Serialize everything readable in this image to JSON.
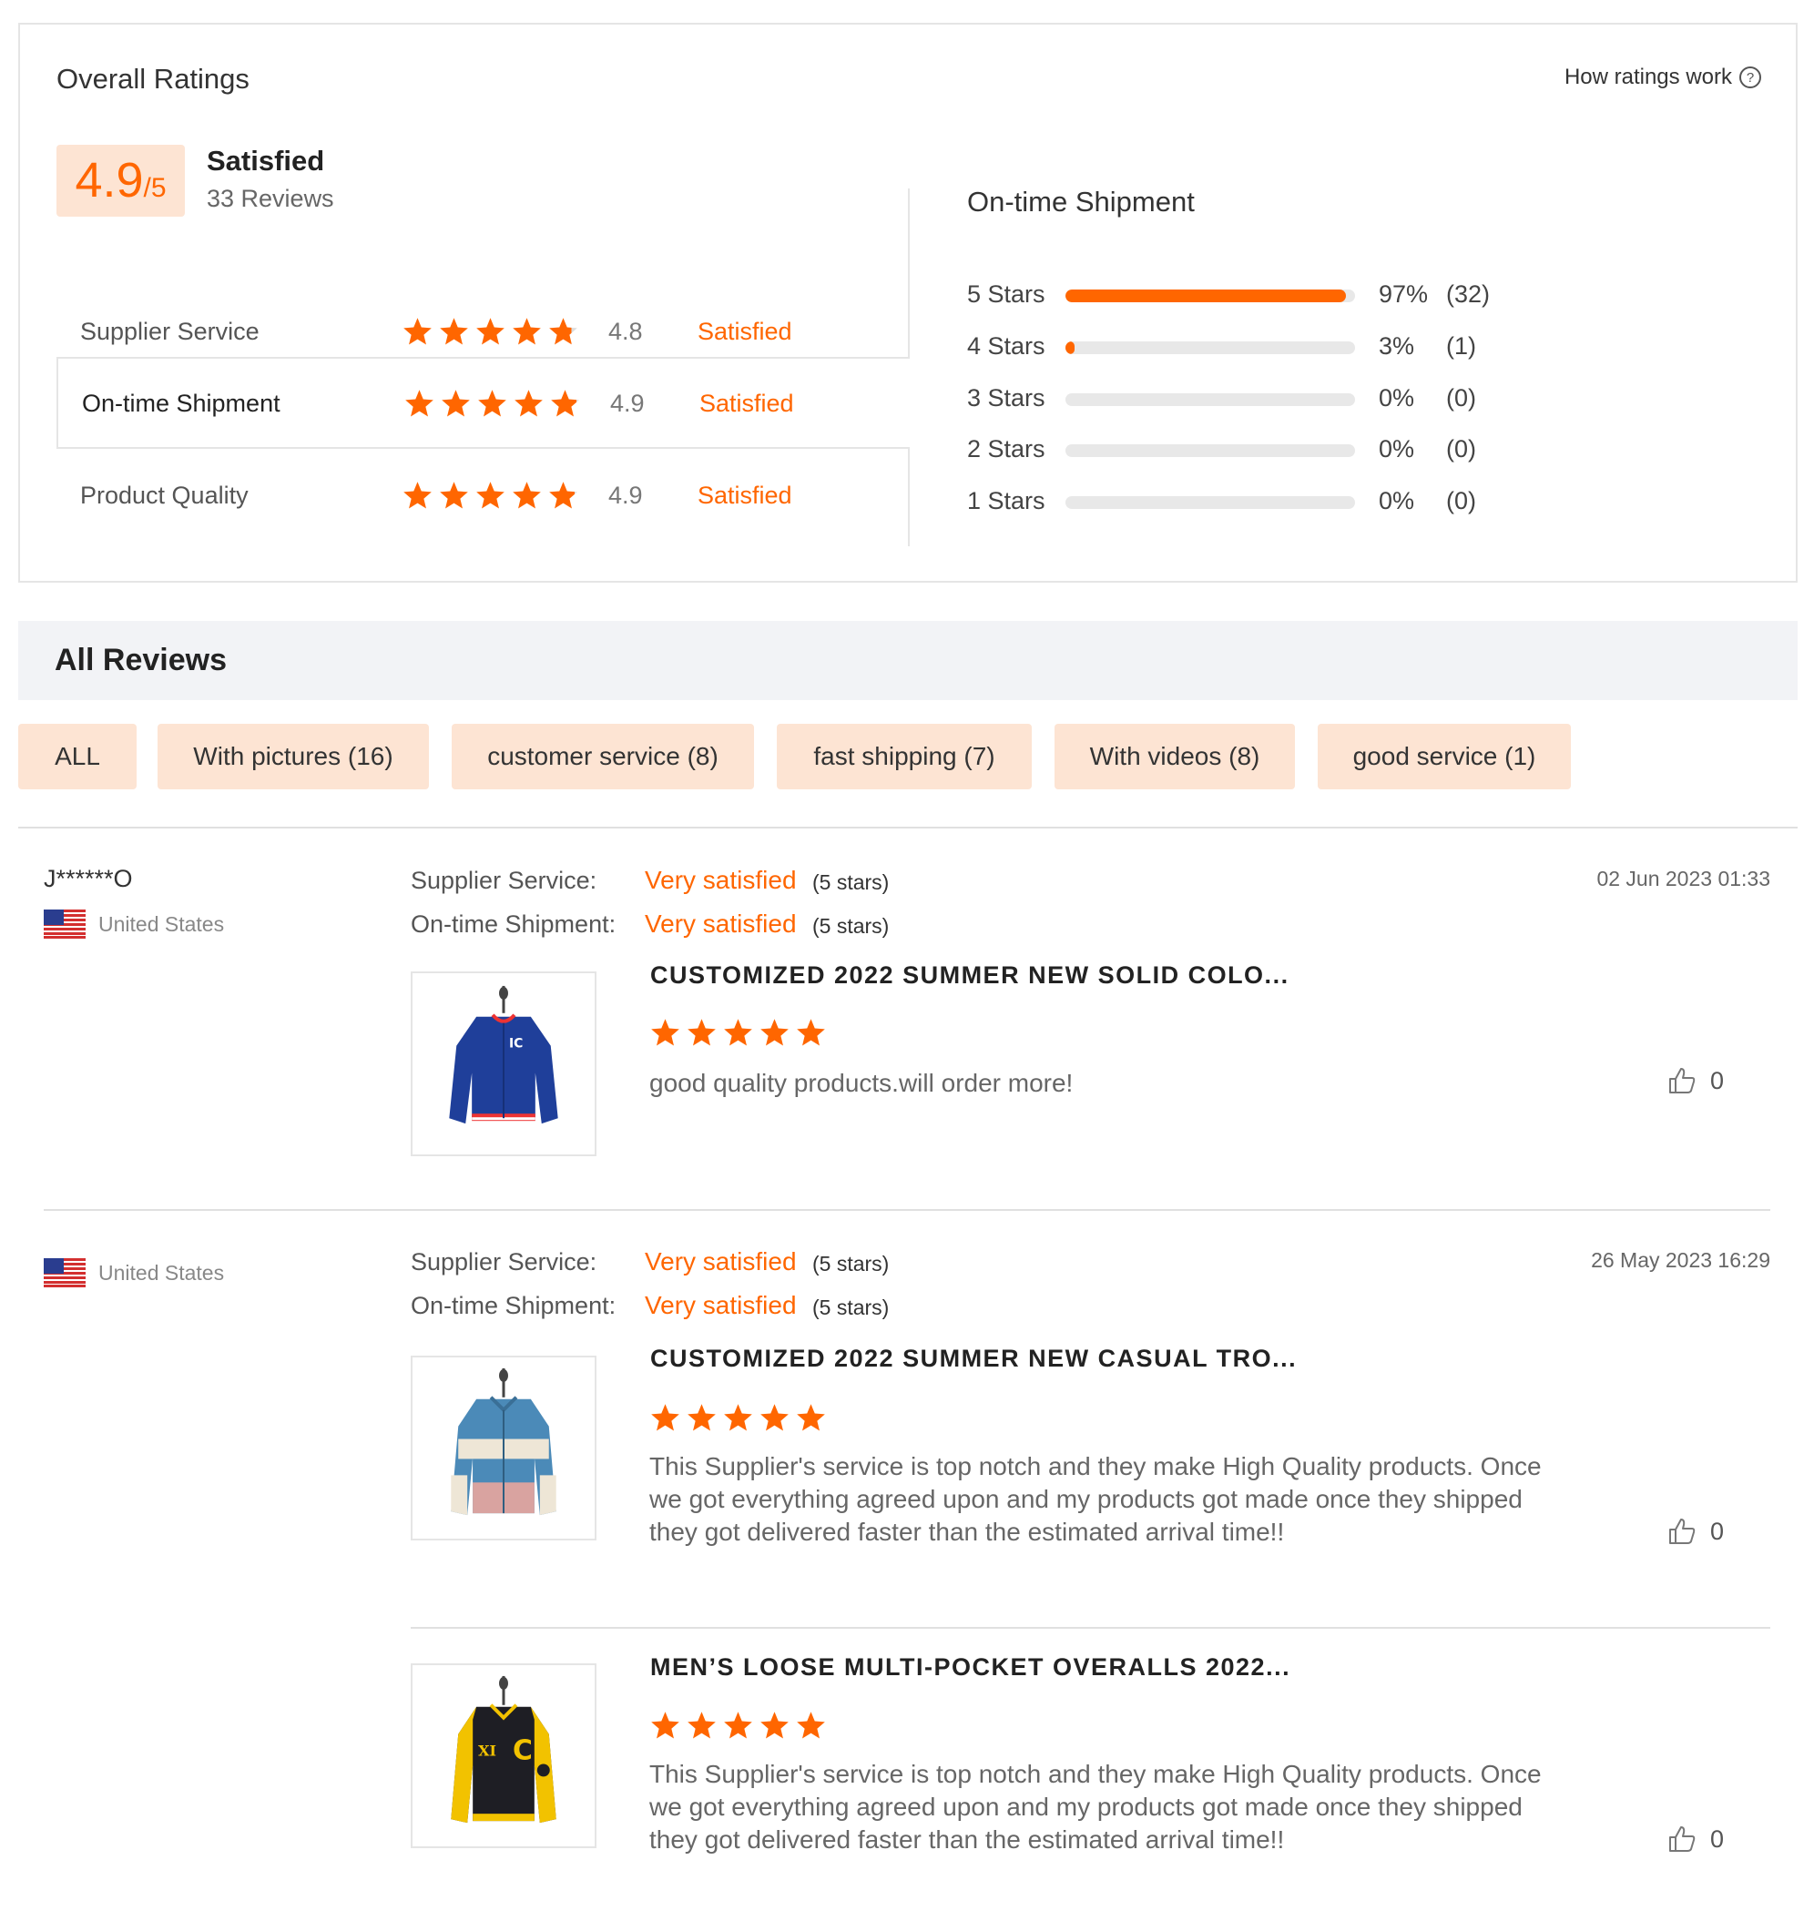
{
  "overall": {
    "title": "Overall Ratings",
    "how_link": "How ratings work",
    "help_icon": "?",
    "score": "4.9",
    "score_suffix": "/5",
    "label": "Satisfied",
    "reviews_count": "33 Reviews",
    "categories": [
      {
        "label": "Supplier Service",
        "rating": 4.8,
        "value": "4.8",
        "status": "Satisfied"
      },
      {
        "label": "On-time Shipment",
        "rating": 4.9,
        "value": "4.9",
        "status": "Satisfied"
      },
      {
        "label": "Product Quality",
        "rating": 4.9,
        "value": "4.9",
        "status": "Satisfied"
      }
    ]
  },
  "distribution": {
    "title": "On-time Shipment",
    "rows": [
      {
        "label": "5  Stars",
        "fraction": 0.97,
        "pct": "97%",
        "count": "(32)"
      },
      {
        "label": "4  Stars",
        "fraction": 0.03,
        "pct": "3%",
        "count": "(1)"
      },
      {
        "label": "3  Stars",
        "fraction": 0,
        "pct": "0%",
        "count": "(0)"
      },
      {
        "label": "2  Stars",
        "fraction": 0,
        "pct": "0%",
        "count": "(0)"
      },
      {
        "label": "1  Stars",
        "fraction": 0,
        "pct": "0%",
        "count": "(0)"
      }
    ]
  },
  "all_reviews": {
    "title": "All Reviews",
    "filters": [
      "ALL",
      "With pictures (16)",
      "customer service (8)",
      "fast shipping (7)",
      "With videos (8)",
      "good service (1)"
    ]
  },
  "reviews": [
    {
      "name": "J******O",
      "country": "United States",
      "date": "02 Jun 2023 01:33",
      "supplier_label": "Supplier Service:",
      "supplier_value": "Very satisfied",
      "supplier_note": "(5 stars)",
      "shipment_label": "On-time Shipment:",
      "shipment_value": "Very satisfied",
      "shipment_note": "(5 stars)",
      "products": [
        {
          "title": "CUSTOMIZED 2022 SUMMER NEW SOLID COLO...",
          "stars": 5,
          "comment": "good quality products.will order more!",
          "likes": "0",
          "image": "blue-varsity-jacket"
        }
      ]
    },
    {
      "name": "",
      "country": "United States",
      "date": "26 May 2023 16:29",
      "supplier_label": "Supplier Service:",
      "supplier_value": "Very satisfied",
      "supplier_note": "(5 stars)",
      "shipment_label": "On-time Shipment:",
      "shipment_value": "Very satisfied",
      "shipment_note": "(5 stars)",
      "products": [
        {
          "title": "CUSTOMIZED 2022 SUMMER NEW CASUAL TRO...",
          "stars": 5,
          "comment": "This Supplier's service is top notch and they make High Quality products. Once we got everything agreed upon and my products got made once they shipped they got delivered faster than the estimated arrival time!!",
          "likes": "0",
          "image": "striped-blue-cream-pink-jacket"
        },
        {
          "title": "MEN’S LOOSE MULTI-POCKET OVERALLS 2022...",
          "stars": 5,
          "comment": "This Supplier's service is top notch and they make High Quality products. Once we got everything agreed upon and my products got made once they shipped they got delivered faster than the estimated arrival time!!",
          "likes": "0",
          "image": "black-yellow-varsity-jacket"
        }
      ]
    }
  ],
  "colors": {
    "accent": "#ff6600",
    "chip_bg": "#fde4d3",
    "header_bg": "#f2f3f6",
    "border": "#e5e5e5"
  }
}
